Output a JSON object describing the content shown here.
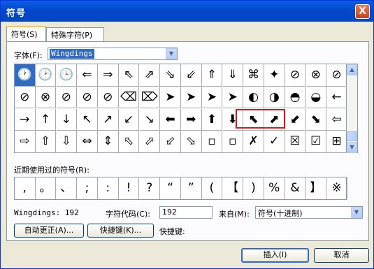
{
  "window": {
    "title": "符号",
    "close_label": "X"
  },
  "tabs": [
    {
      "label": "符号(S)"
    },
    {
      "label": "特殊字符(P)"
    }
  ],
  "font": {
    "label": "字体(F):",
    "value": "Wingdings"
  },
  "symbols": [
    [
      "🕐",
      "🕑",
      "🕒",
      "⇐",
      "⇒",
      "⇖",
      "⇗",
      "⇘",
      "⇙",
      "⇑",
      "⇓",
      "⌘",
      "✦",
      "⊘",
      "⊗",
      "⊘"
    ],
    [
      "⊘",
      "⊗",
      "⊘",
      "⊘",
      "⊘",
      "⌫",
      "⌦",
      "➤",
      "➤",
      "➤",
      "➤",
      "◐",
      "◑",
      "◓",
      "◒",
      "←"
    ],
    [
      "→",
      "↑",
      "↓",
      "↖",
      "↗",
      "↙",
      "↘",
      "⬅",
      "➡",
      "⬆",
      "⬇",
      "⬉",
      "⬈",
      "⬋",
      "⬊",
      "⇦"
    ],
    [
      "⇨",
      "⇧",
      "⇩",
      "⇔",
      "⇕",
      "⬁",
      "⬀",
      "⬃",
      "⬂",
      "▫",
      "▫",
      "✗",
      "✓",
      "☒",
      "☑",
      "⊞"
    ]
  ],
  "recent": {
    "label": "近期使用过的符号(R):",
    "items": [
      ",",
      "。",
      "、",
      ";",
      ":",
      "!",
      "?",
      "“",
      "”",
      "(",
      "【",
      ")",
      "%",
      "&",
      "】",
      "※"
    ]
  },
  "footer": {
    "char_name": "Wingdings: 192",
    "code_label": "字符代码(C):",
    "code_value": "192",
    "from_label": "来自(M):",
    "from_value": "符号(十进制)",
    "autocorrect_button": "自动更正(A)...",
    "shortcut_button": "快捷键(K)...",
    "shortcut_label": "快捷键:"
  },
  "buttons": {
    "insert": "插入(I)",
    "cancel": "取消"
  },
  "colors": {
    "title_bar": "#0446c8",
    "selection": "#316ac5",
    "highlight_box": "#d21a1a"
  }
}
